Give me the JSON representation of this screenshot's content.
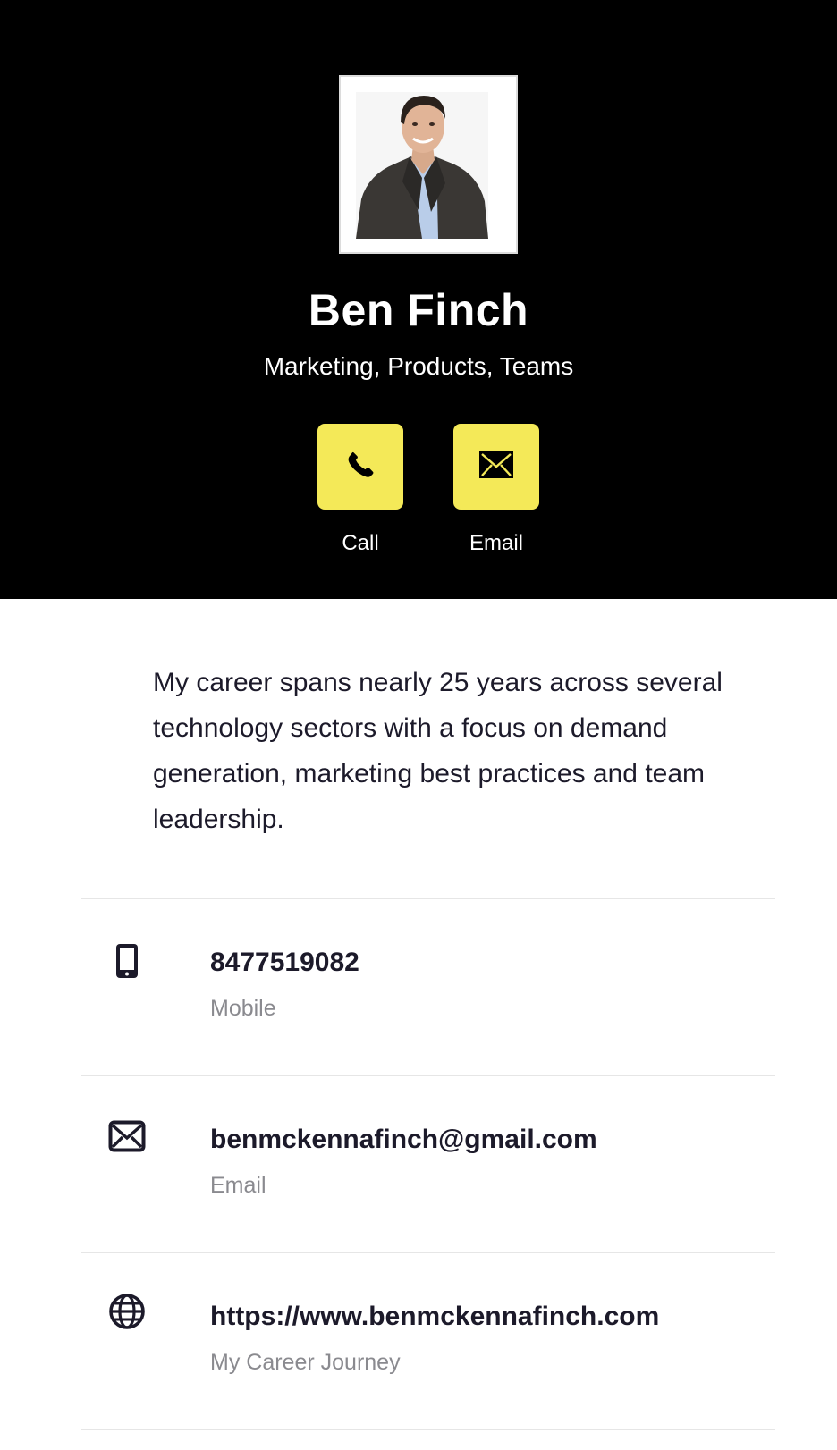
{
  "profile": {
    "name": "Ben Finch",
    "headline": "Marketing, Products, Teams",
    "photo_icon": "profile-photo"
  },
  "actions": [
    {
      "label": "Call",
      "icon": "phone-icon"
    },
    {
      "label": "Email",
      "icon": "envelope-icon"
    }
  ],
  "bio": "My career spans nearly 25 years across several technology sectors with a focus on demand generation, marketing best practices and team leadership.",
  "contacts": [
    {
      "value": "8477519082",
      "label": "Mobile",
      "icon": "mobile-phone-icon"
    },
    {
      "value": "benmckennafinch@gmail.com",
      "label": "Email",
      "icon": "envelope-icon"
    },
    {
      "value": "https://www.benmckennafinch.com",
      "label": "My Career Journey",
      "icon": "globe-icon"
    }
  ],
  "colors": {
    "hero_background": "#000000",
    "accent": "#f4e958",
    "text_dark": "#1c1a2a",
    "text_muted": "#8a8a8f",
    "divider": "#e6e6e6"
  }
}
